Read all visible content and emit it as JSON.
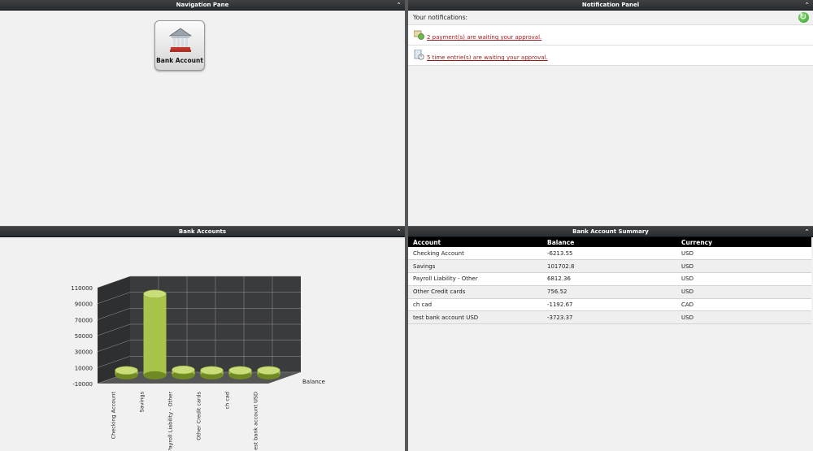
{
  "nav_pane": {
    "title": "Navigation Pane",
    "tile_label": "Bank Account"
  },
  "notification_panel": {
    "title": "Notification Panel",
    "heading": "Your notifications:",
    "items": [
      {
        "text": " 2 payment(s) are waiting your approval.",
        "icon": "payment-icon"
      },
      {
        "text": " 5 time entrie(s) are waiting your approval.",
        "icon": "time-entry-icon"
      }
    ]
  },
  "bank_accounts": {
    "title": "Bank Accounts"
  },
  "summary": {
    "title": "Bank Account Summary",
    "columns": [
      "Account",
      "Balance",
      "Currency"
    ],
    "rows": [
      [
        "Checking Account",
        "-6213.55",
        "USD"
      ],
      [
        "Savings",
        "101702.8",
        "USD"
      ],
      [
        "Payroll Liability - Other",
        "6812.36",
        "USD"
      ],
      [
        "Other Credit cards",
        "756.52",
        "USD"
      ],
      [
        "ch cad",
        "-1192.67",
        "CAD"
      ],
      [
        "test bank account USD",
        "-3723.37",
        "USD"
      ]
    ]
  },
  "chart_data": {
    "type": "bar",
    "categories": [
      "Checking Account",
      "Savings",
      "Payroll Liability - Other",
      "Other Credit cards",
      "ch cad",
      "test bank account USD"
    ],
    "series": [
      {
        "name": "Balance",
        "values": [
          -6213.55,
          101702.8,
          6812.36,
          756.52,
          -1192.67,
          -3723.37
        ]
      }
    ],
    "ytick_labels": [
      "110000",
      "90000",
      "70000",
      "50000",
      "30000",
      "10000",
      "-10000"
    ],
    "ylim": [
      -10000,
      110000
    ],
    "bar_color": "#a9c44a",
    "legend_position": "right"
  },
  "colors": {
    "header_bg": "#2e3134",
    "link": "#9b1b1b",
    "panel_bg": "#f1f1f1"
  }
}
